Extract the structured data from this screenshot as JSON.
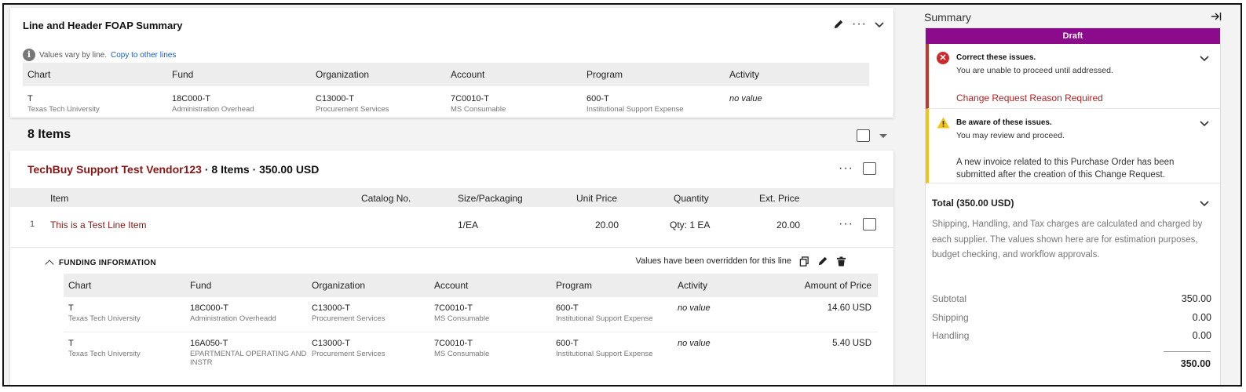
{
  "foap": {
    "title": "Line and Header FOAP Summary",
    "info_text": "Values vary by line.",
    "copy_link": "Copy to other lines",
    "columns": [
      "Chart",
      "Fund",
      "Organization",
      "Account",
      "Program",
      "Activity"
    ],
    "row": {
      "chart": "T",
      "chart_sub": "Texas Tech University",
      "fund": "18C000-T",
      "fund_sub": "Administration Overhead",
      "org": "C13000-T",
      "org_sub": "Procurement Services",
      "account": "7C0010-T",
      "account_sub": "MS Consumable",
      "program": "600-T",
      "program_sub": "Institutional Support Expense",
      "activity": "no value"
    }
  },
  "items": {
    "title": "8 Items"
  },
  "vendor": {
    "name": "TechBuy Support Test Vendor123",
    "summary": " · 8 Items · 350.00 USD",
    "columns": [
      "Item",
      "Catalog No.",
      "Size/Packaging",
      "Unit Price",
      "Quantity",
      "Ext. Price"
    ],
    "line": {
      "num": "1",
      "item": "This is a Test Line Item",
      "size": "1/EA",
      "unit_price": "20.00",
      "quantity": "Qty: 1 EA",
      "ext_price": "20.00"
    }
  },
  "funding": {
    "title": "FUNDING INFORMATION",
    "override_text": "Values have been overridden for this line",
    "columns": [
      "Chart",
      "Fund",
      "Organization",
      "Account",
      "Program",
      "Activity",
      "Amount of Price"
    ],
    "rows": [
      {
        "chart": "T",
        "chart_sub": "Texas Tech University",
        "fund": "18C000-T",
        "fund_sub": "Administration Overheadd",
        "org": "C13000-T",
        "org_sub": "Procurement Services",
        "account": "7C0010-T",
        "account_sub": "MS Consumable",
        "program": "600-T",
        "program_sub": "Institutional Support Expense",
        "activity": "no value",
        "amount": "14.60 USD"
      },
      {
        "chart": "T",
        "chart_sub": "Texas Tech University",
        "fund": "16A050-T",
        "fund_sub": "EPARTMENTAL OPERATING AND INSTR",
        "org": "C13000-T",
        "org_sub": "Procurement Services",
        "account": "7C0010-T",
        "account_sub": "MS Consumable",
        "program": "600-T",
        "program_sub": "Institutional Support Expense",
        "activity": "no value",
        "amount": "5.40 USD"
      }
    ]
  },
  "summary": {
    "title": "Summary",
    "status": "Draft",
    "error": {
      "head": "Correct these issues.",
      "sub": "You are unable to proceed until addressed.",
      "item": "Change Request Reason Required"
    },
    "warning": {
      "head": "Be aware of these issues.",
      "sub": "You may review and proceed.",
      "message": "A new invoice related to this Purchase Order has been submitted after the creation of this Change Request."
    },
    "total_label": "Total (350.00 USD)",
    "note": "Shipping, Handling, and Tax charges are calculated and charged by each supplier. The values shown here are for estimation purposes, budget checking, and workflow approvals.",
    "lines": [
      {
        "label": "Subtotal",
        "value": "350.00"
      },
      {
        "label": "Shipping",
        "value": "0.00"
      },
      {
        "label": "Handling",
        "value": "0.00"
      }
    ],
    "grand_total": "350.00"
  },
  "colors": {
    "accent_red": "#8b1515",
    "draft_purple": "#8c0a8c",
    "error_red": "#cc2b2b",
    "warning_yellow": "#f0c419",
    "link_blue": "#1a5fb4"
  }
}
